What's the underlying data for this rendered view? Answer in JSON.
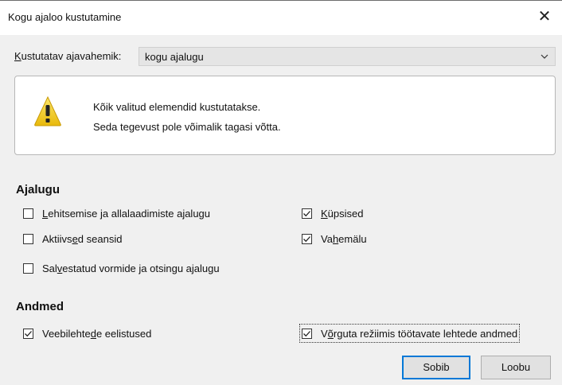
{
  "window": {
    "title": "Kogu ajaloo kustutamine",
    "close_glyph": "✕"
  },
  "range": {
    "label_accel": "K",
    "label_rest": "ustutatav ajavahemik:",
    "selected": "kogu ajalugu"
  },
  "warning": {
    "line1": "Kõik valitud elemendid kustutatakse.",
    "line2": "Seda tegevust pole võimalik tagasi võtta."
  },
  "history": {
    "heading": "Ajalugu",
    "items": [
      {
        "pre": "",
        "accel": "L",
        "post": "ehitsemise ja allalaadimiste ajalugu",
        "checked": false
      },
      {
        "pre": "Aktiivs",
        "accel": "e",
        "post": "d seansid",
        "checked": false
      },
      {
        "pre": "Sal",
        "accel": "v",
        "post": "estatud vormide ja otsingu ajalugu",
        "checked": false
      },
      {
        "pre": "",
        "accel": "K",
        "post": "üpsised",
        "checked": true
      },
      {
        "pre": "Va",
        "accel": "h",
        "post": "emälu",
        "checked": true
      }
    ]
  },
  "data": {
    "heading": "Andmed",
    "items": [
      {
        "pre": "Veebilehte",
        "accel": "d",
        "post": "e eelistused",
        "checked": true
      },
      {
        "pre": "V",
        "accel": "õ",
        "post": "rguta režiimis töötavate lehtede andmed",
        "checked": true
      }
    ]
  },
  "buttons": {
    "ok": "Sobib",
    "cancel": "Loobu"
  },
  "colors": {
    "dialog_bg": "#f0f0f0",
    "default_button_border": "#0078d7",
    "warning_yellow": "#f7d21e"
  },
  "icons": {
    "close": "close-icon",
    "dropdown": "chevron-down-icon",
    "warning": "warning-icon",
    "checkmark": "checkmark-icon"
  }
}
